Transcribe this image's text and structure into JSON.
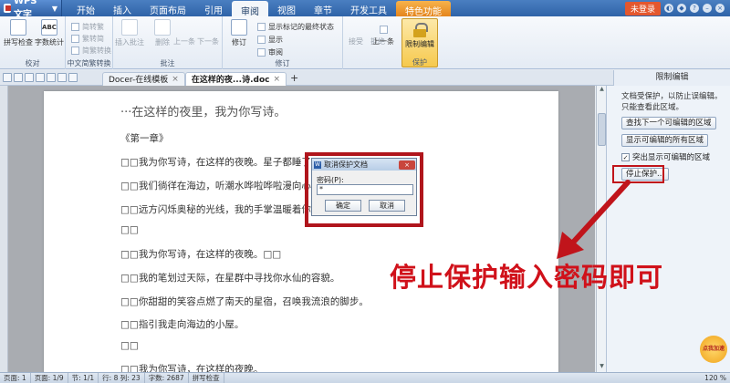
{
  "app": {
    "name": "WPS 文字"
  },
  "menu": {
    "tabs": [
      "开始",
      "插入",
      "页面布局",
      "引用",
      "审阅",
      "视图",
      "章节",
      "开发工具",
      "特色功能"
    ],
    "active": "审阅",
    "login": "未登录"
  },
  "ribbon": {
    "spell_check": "拼写检查",
    "word_count": "字数统计",
    "abc": "ABC",
    "group_proofing": "校对",
    "to_traditional": "简转繁",
    "to_simplified": "繁转简",
    "s_t_convert": "简繁转换",
    "group_chinese": "中文简繁转换",
    "insert_comment": "插入批注",
    "delete": "删除",
    "prev": "上一条",
    "next": "下一条",
    "group_comment": "批注",
    "revise": "修订",
    "show_final": "显示标记的最终状态",
    "show": "显示",
    "review": "审阅",
    "group_revise": "修订",
    "accept": "接受",
    "reject": "拒绝",
    "prev2": "上一条",
    "next2": "下一条",
    "restrict_edit": "限制编辑",
    "group_protect": "保护"
  },
  "tabs": {
    "docer": "Docer-在线模板",
    "doc": "在这样的夜...诗.doc",
    "add": "+"
  },
  "document": {
    "title": "···在这样的夜里，我为你写诗。",
    "lines": [
      "《第一章》",
      "□□我为你写诗，在这样的夜晚。星子都睡了，",
      "□□我们徜徉在海边，听潮水哗啦哗啦漫向心底",
      "□□远方闪烁奥秘的光线，我的手掌温暖着你纤",
      "□□",
      "□□我为你写诗，在这样的夜晚。□□",
      "□□我的笔划过天际，在星群中寻找你水仙的容貌。",
      "□□你甜甜的笑容点燃了南天的星宿，召唤我流浪的脚步。",
      "□□指引我走向海边的小屋。",
      "□□",
      "□□我为你写诗，在这样的夜晚。"
    ]
  },
  "pane": {
    "title": "限制编辑",
    "text": "文档受保护，以防止误编辑。只能查看此区域。",
    "find_next": "查找下一个可编辑的区域",
    "show_all": "显示可编辑的所有区域",
    "highlight": "突出显示可编辑的区域",
    "stop": "停止保护..."
  },
  "dialog": {
    "title": "取消保护文档",
    "password_label": "密码(P):",
    "password_value": "*",
    "ok": "确定",
    "cancel": "取消"
  },
  "annotation": {
    "text": "停止保护输入密码即可"
  },
  "status": {
    "page": "页面: 1",
    "pages": "页面: 1/9",
    "section": "节: 1/1",
    "pos": "行: 8  列: 23",
    "words": "字数: 2687",
    "spell": "拼写检查",
    "zoom": "120 %"
  },
  "badge": {
    "text": "点我加速"
  },
  "colors": {
    "accent": "#2f63a8",
    "highlight": "#c0141b"
  }
}
